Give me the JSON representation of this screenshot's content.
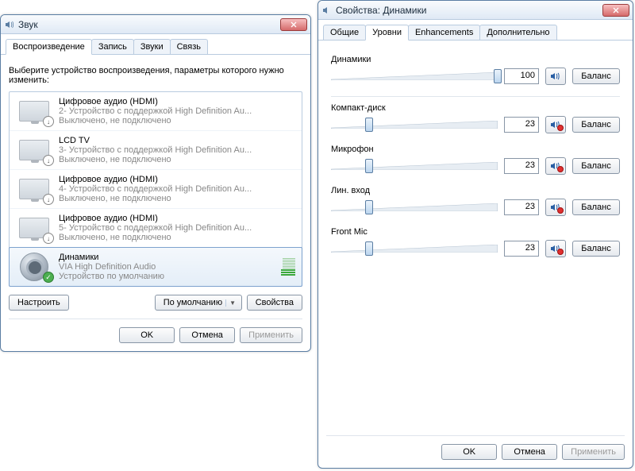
{
  "win1": {
    "title": "Звук",
    "tabs": [
      "Воспроизведение",
      "Запись",
      "Звуки",
      "Связь"
    ],
    "activeTab": 0,
    "instruction": "Выберите устройство воспроизведения, параметры которого нужно изменить:",
    "devices": [
      {
        "name": "Цифровое аудио (HDMI)",
        "line2": "2- Устройство с поддержкой High Definition Au...",
        "line3": "Выключено, не подключено",
        "icon": "monitor",
        "badge": "down"
      },
      {
        "name": "LCD TV",
        "line2": "3- Устройство с поддержкой High Definition Au...",
        "line3": "Выключено, не подключено",
        "icon": "monitor",
        "badge": "down"
      },
      {
        "name": "Цифровое аудио (HDMI)",
        "line2": "4- Устройство с поддержкой High Definition Au...",
        "line3": "Выключено, не подключено",
        "icon": "monitor",
        "badge": "down"
      },
      {
        "name": "Цифровое аудио (HDMI)",
        "line2": "5- Устройство с поддержкой High Definition Au...",
        "line3": "Выключено, не подключено",
        "icon": "monitor",
        "badge": "down"
      },
      {
        "name": "Динамики",
        "line2": "VIA High Definition Audio",
        "line3": "Устройство по умолчанию",
        "icon": "speaker",
        "badge": "check",
        "selected": true
      }
    ],
    "buttons": {
      "configure": "Настроить",
      "default": "По умолчанию",
      "properties": "Свойства",
      "ok": "OK",
      "cancel": "Отмена",
      "apply": "Применить"
    }
  },
  "win2": {
    "title": "Свойства: Динамики",
    "tabs": [
      "Общие",
      "Уровни",
      "Enhancements",
      "Дополнительно"
    ],
    "activeTab": 1,
    "levels": [
      {
        "label": "Динамики",
        "value": 100,
        "pos": 100,
        "muted": false
      },
      {
        "label": "Компакт-диск",
        "value": 23,
        "pos": 23,
        "muted": true
      },
      {
        "label": "Микрофон",
        "value": 23,
        "pos": 23,
        "muted": true
      },
      {
        "label": "Лин. вход",
        "value": 23,
        "pos": 23,
        "muted": true
      },
      {
        "label": "Front Mic",
        "value": 23,
        "pos": 23,
        "muted": true
      }
    ],
    "balance": "Баланс",
    "buttons": {
      "ok": "OK",
      "cancel": "Отмена",
      "apply": "Применить"
    }
  }
}
